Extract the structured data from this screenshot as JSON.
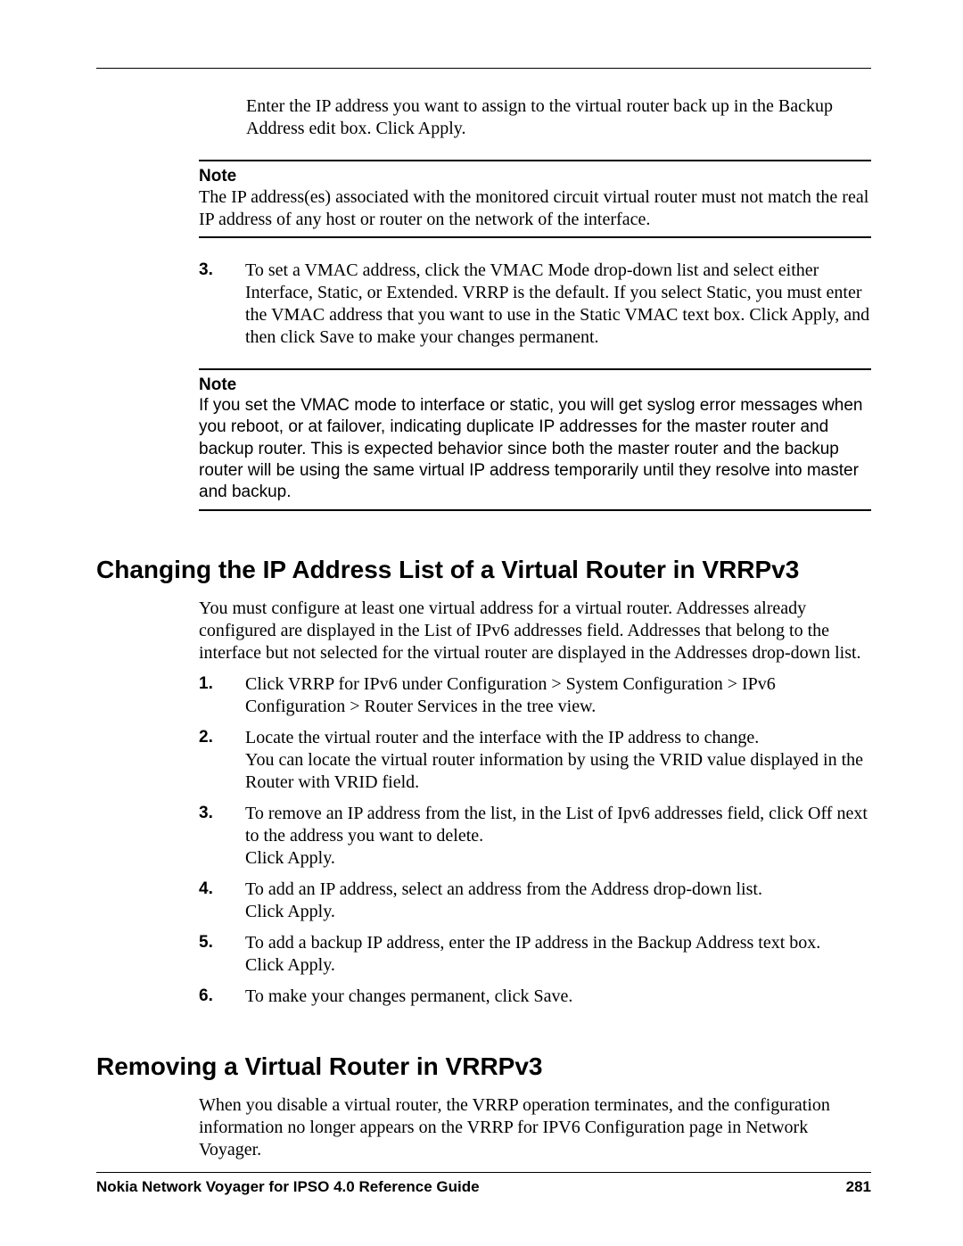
{
  "intro_paragraph": "Enter the IP address you want to assign to the virtual router back up in the Backup Address edit box. Click Apply.",
  "note1": {
    "label": "Note",
    "body": "The IP address(es) associated with the monitored circuit virtual router must not match the real IP address of any host or router on the network of the interface."
  },
  "step3": {
    "num": "3.",
    "text": "To set a VMAC address, click the VMAC Mode drop-down list and select either Interface, Static, or Extended. VRRP is the default. If you select Static, you must enter the VMAC address that you want to use in the Static VMAC text box. Click Apply, and then click Save to make your changes permanent."
  },
  "note2": {
    "label": "Note",
    "body": "If you set the VMAC mode to interface or static, you will get syslog error messages when you reboot, or at failover, indicating duplicate IP addresses for the master router and backup router. This is expected behavior since both the master router and the backup router will be using the same virtual IP address temporarily until they resolve into master and backup."
  },
  "sections": [
    {
      "heading": "Changing the IP Address List of a Virtual Router in VRRPv3",
      "intro": "You must configure at least one virtual address for a virtual router. Addresses already configured are displayed in the List of IPv6 addresses field. Addresses that belong to the interface but not selected for the virtual router are displayed in the Addresses drop-down list.",
      "items": [
        {
          "num": "1.",
          "text": "Click VRRP for IPv6 under Configuration > System Configuration > IPv6 Configuration > Router Services in the tree view."
        },
        {
          "num": "2.",
          "text": "Locate the virtual router and the interface with the IP address to change.\nYou can locate the virtual router information by using the VRID value displayed in the Router with VRID field."
        },
        {
          "num": "3.",
          "text": "To remove an IP address from the list, in the List of Ipv6 addresses field, click Off next to the address you want to delete.\nClick Apply."
        },
        {
          "num": "4.",
          "text": "To add an IP address, select an address from the Address drop-down list.\nClick Apply."
        },
        {
          "num": "5.",
          "text": "To add a backup IP address, enter the IP address in the Backup Address text box.\nClick Apply."
        },
        {
          "num": "6.",
          "text": "To make your changes permanent, click Save."
        }
      ]
    },
    {
      "heading": "Removing a Virtual Router in VRRPv3",
      "intro": "When you disable a virtual router, the VRRP operation terminates, and the configuration information no longer appears on the VRRP for IPV6 Configuration page in Network Voyager.",
      "items": []
    }
  ],
  "footer": {
    "title": "Nokia Network Voyager for IPSO 4.0 Reference Guide",
    "page": "281"
  }
}
